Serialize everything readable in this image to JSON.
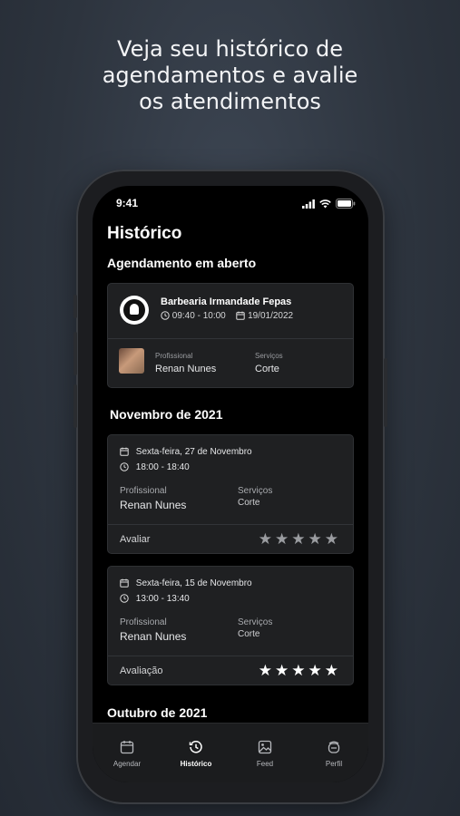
{
  "headline": {
    "line1": "Veja seu histórico de",
    "line2": "agendamentos e avalie",
    "line3": "os atendimentos"
  },
  "status_bar": {
    "time": "9:41"
  },
  "page_title": "Histórico",
  "open_section": {
    "heading": "Agendamento em aberto",
    "card": {
      "shop_name": "Barbearia Irmandade Fepas",
      "time": "09:40 - 10:00",
      "date": "19/01/2022",
      "professional_label": "Profissional",
      "professional_name": "Renan Nunes",
      "services_label": "Serviços",
      "services_value": "Corte"
    }
  },
  "november_section": {
    "heading": "Novembro de 2021",
    "cards": [
      {
        "date": "Sexta-feira, 27 de Novembro",
        "time": "18:00 - 18:40",
        "professional_label": "Profissional",
        "professional_name": "Renan Nunes",
        "services_label": "Serviços",
        "services_value": "Corte",
        "rating_label": "Avaliar",
        "rating": 0,
        "star_color": "#9a9ca0"
      },
      {
        "date": "Sexta-feira, 15 de Novembro",
        "time": "13:00 - 13:40",
        "professional_label": "Profissional",
        "professional_name": "Renan Nunes",
        "services_label": "Serviços",
        "services_value": "Corte",
        "rating_label": "Avaliação",
        "rating": 5,
        "star_color": "#ffffff"
      }
    ]
  },
  "october_section": {
    "heading": "Outubro de 2021"
  },
  "tab_bar": {
    "tabs": [
      {
        "label": "Agendar",
        "icon": "calendar-icon",
        "active": false
      },
      {
        "label": "Histórico",
        "icon": "history-icon",
        "active": true
      },
      {
        "label": "Feed",
        "icon": "image-icon",
        "active": false
      },
      {
        "label": "Perfil",
        "icon": "profile-icon",
        "active": false
      }
    ]
  }
}
